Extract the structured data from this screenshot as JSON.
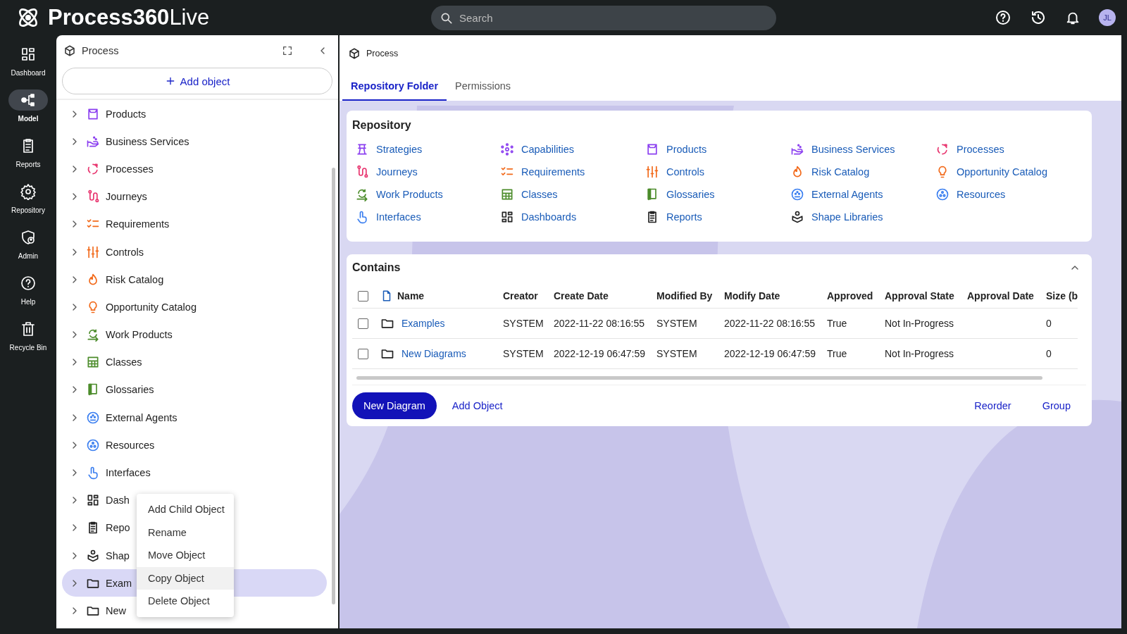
{
  "app": {
    "logo_text": "**Process360**Live"
  },
  "search": {
    "placeholder": "Search"
  },
  "user": {
    "initials": "JL"
  },
  "rail": [
    {
      "label": "Dashboard",
      "selected": false
    },
    {
      "label": "Model",
      "selected": true
    },
    {
      "label": "Reports",
      "selected": false
    },
    {
      "label": "Repository",
      "selected": false
    },
    {
      "label": "Admin",
      "selected": false
    },
    {
      "label": "Help",
      "selected": false
    },
    {
      "label": "Recycle Bin",
      "selected": false
    }
  ],
  "tree_panel": {
    "title": "Process",
    "add_button": "Add object",
    "items": [
      {
        "label": "Products",
        "color": "#8b3ff0",
        "selected": false
      },
      {
        "label": "Business Services",
        "color": "#8b3ff0",
        "selected": false
      },
      {
        "label": "Processes",
        "color": "#e8346e",
        "selected": false
      },
      {
        "label": "Journeys",
        "color": "#e8346e",
        "selected": false
      },
      {
        "label": "Requirements",
        "color": "#f26a1b",
        "selected": false
      },
      {
        "label": "Controls",
        "color": "#f26a1b",
        "selected": false
      },
      {
        "label": "Risk Catalog",
        "color": "#f26a1b",
        "selected": false
      },
      {
        "label": "Opportunity Catalog",
        "color": "#f26a1b",
        "selected": false
      },
      {
        "label": "Work Products",
        "color": "#4c8c2b",
        "selected": false
      },
      {
        "label": "Classes",
        "color": "#4c8c2b",
        "selected": false
      },
      {
        "label": "Glossaries",
        "color": "#4c8c2b",
        "selected": false
      },
      {
        "label": "External Agents",
        "color": "#3b7ff0",
        "selected": false
      },
      {
        "label": "Resources",
        "color": "#3b7ff0",
        "selected": false
      },
      {
        "label": "Interfaces",
        "color": "#3b7ff0",
        "selected": false
      },
      {
        "label": "Dash",
        "color": "#222222",
        "selected": false
      },
      {
        "label": "Repo",
        "color": "#222222",
        "selected": false
      },
      {
        "label": "Shap",
        "color": "#222222",
        "selected": false
      },
      {
        "label": "Exam",
        "color": "#222222",
        "selected": true
      },
      {
        "label": "New",
        "color": "#222222",
        "selected": false
      }
    ]
  },
  "context_menu": [
    {
      "label": "Add Child Object",
      "selected": false
    },
    {
      "label": "Rename",
      "selected": false
    },
    {
      "label": "Move Object",
      "selected": false
    },
    {
      "label": "Copy Object",
      "selected": true
    },
    {
      "label": "Delete Object",
      "selected": false
    }
  ],
  "main": {
    "title": "Process",
    "tabs": [
      {
        "label": "Repository Folder",
        "selected": true
      },
      {
        "label": "Permissions",
        "selected": false
      }
    ],
    "repository": {
      "title": "Repository",
      "items": [
        {
          "label": "Strategies",
          "color": "#8b3ff0"
        },
        {
          "label": "Capabilities",
          "color": "#8b3ff0"
        },
        {
          "label": "Products",
          "color": "#8b3ff0"
        },
        {
          "label": "Business Services",
          "color": "#8b3ff0"
        },
        {
          "label": "Processes",
          "color": "#e8346e"
        },
        {
          "label": "Journeys",
          "color": "#e8346e"
        },
        {
          "label": "Requirements",
          "color": "#f26a1b"
        },
        {
          "label": "Controls",
          "color": "#f26a1b"
        },
        {
          "label": "Risk Catalog",
          "color": "#f26a1b"
        },
        {
          "label": "Opportunity Catalog",
          "color": "#f26a1b"
        },
        {
          "label": "Work Products",
          "color": "#4c8c2b"
        },
        {
          "label": "Classes",
          "color": "#4c8c2b"
        },
        {
          "label": "Glossaries",
          "color": "#4c8c2b"
        },
        {
          "label": "External Agents",
          "color": "#3b7ff0"
        },
        {
          "label": "Resources",
          "color": "#3b7ff0"
        },
        {
          "label": "Interfaces",
          "color": "#3b7ff0"
        },
        {
          "label": "Dashboards",
          "color": "#222222"
        },
        {
          "label": "Reports",
          "color": "#222222"
        },
        {
          "label": "Shape Libraries",
          "color": "#222222"
        }
      ]
    },
    "contains": {
      "title": "Contains",
      "select_all": {
        "checked": false
      },
      "table": {
        "columns": [
          "Name",
          "Creator",
          "Create Date",
          "Modified By",
          "Modify Date",
          "Approved",
          "Approval State",
          "Approval Date",
          "Size (b"
        ],
        "rows": [
          {
            "checked": false,
            "cells": [
              "Examples",
              "SYSTEM",
              "2022-11-22 08:16:55",
              "SYSTEM",
              "2022-11-22 08:16:55",
              "True",
              "Not In-Progress",
              "",
              "0"
            ]
          },
          {
            "checked": false,
            "cells": [
              "New Diagrams",
              "SYSTEM",
              "2022-12-19 06:47:59",
              "SYSTEM",
              "2022-12-19 06:47:59",
              "True",
              "Not In-Progress",
              "",
              "0"
            ]
          }
        ]
      },
      "buttons_left": [
        "New Diagram",
        "Add Object"
      ],
      "buttons_right": [
        "Reorder",
        "Group"
      ]
    }
  }
}
